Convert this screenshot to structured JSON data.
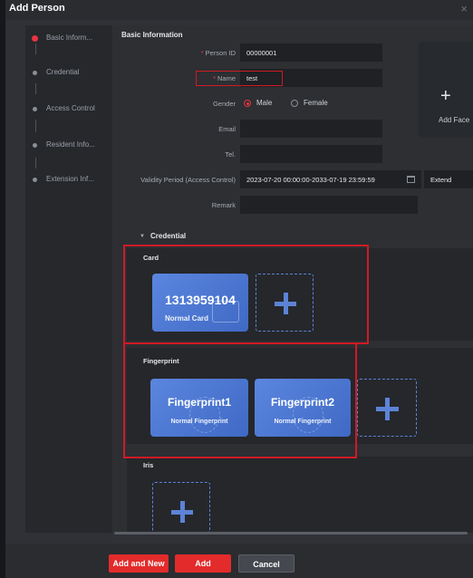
{
  "dialog": {
    "title": "Add Person"
  },
  "nav": {
    "items": [
      {
        "label": "Basic Inform..."
      },
      {
        "label": "Credential"
      },
      {
        "label": "Access Control"
      },
      {
        "label": "Resident Info..."
      },
      {
        "label": "Extension Inf..."
      }
    ]
  },
  "basic": {
    "section_title": "Basic Information",
    "person_id": {
      "label": "Person ID",
      "value": "00000001"
    },
    "name": {
      "label": "Name",
      "value": "test"
    },
    "gender": {
      "label": "Gender",
      "male": "Male",
      "female": "Female",
      "selected": "Male"
    },
    "email": {
      "label": "Email",
      "value": ""
    },
    "tel": {
      "label": "Tel.",
      "value": ""
    },
    "validity": {
      "label": "Validity Period (Access Control)",
      "value": "2023-07-20 00:00:00-2033-07-19 23:59:59",
      "extend": "Extend"
    },
    "remark": {
      "label": "Remark",
      "value": ""
    },
    "add_face": "Add Face"
  },
  "credential": {
    "section_title": "Credential",
    "card": {
      "title": "Card",
      "number": "1313959104",
      "type": "Normal Card"
    },
    "fingerprint": {
      "title": "Fingerprint",
      "items": [
        {
          "name": "Fingerprint1",
          "type": "Normal Fingerprint"
        },
        {
          "name": "Fingerprint2",
          "type": "Normal Fingerprint"
        }
      ]
    },
    "iris": {
      "title": "Iris"
    }
  },
  "footer": {
    "add_and_new": "Add and New",
    "add": "Add",
    "cancel": "Cancel"
  },
  "colors": {
    "accent_red": "#e32b2b",
    "card_blue": "#4f79d4",
    "annotation_red": "#d01a24"
  }
}
